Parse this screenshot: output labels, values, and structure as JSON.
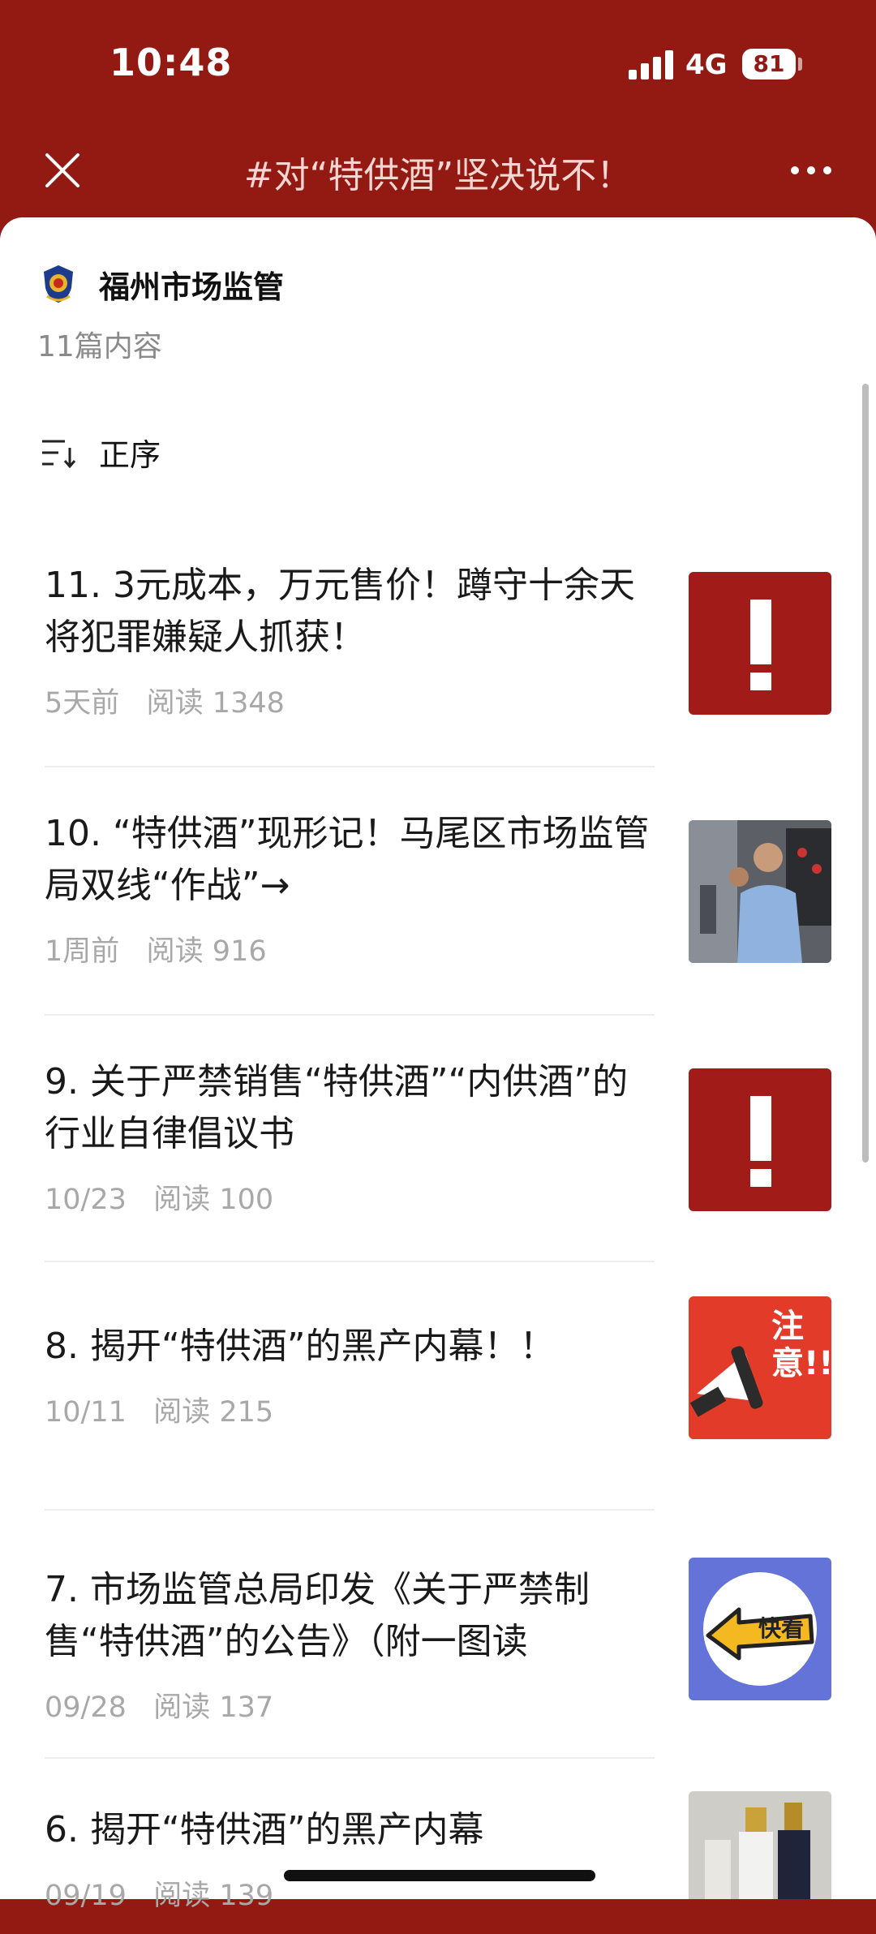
{
  "status": {
    "time": "10:48",
    "network": "4G",
    "battery": "81"
  },
  "nav": {
    "title": "#对“特供酒”坚决说不！"
  },
  "account": {
    "name": "福州市场监管",
    "content_count": "11篇内容"
  },
  "sort": {
    "label": "正序"
  },
  "articles": [
    {
      "title": "11. 3元成本，万元售价！蹲守十余天将犯罪嫌疑人抓获！",
      "time": "5天前",
      "reads": "阅读 1348",
      "thumb": "alert-exclamation"
    },
    {
      "title": "10. “特供酒”现形记！马尾区市场监管局双线“作战”→",
      "time": "1周前",
      "reads": "阅读 916",
      "thumb": "inspection-photo"
    },
    {
      "title": "9. 关于严禁销售“特供酒”“内供酒”的行业自律倡议书",
      "time": "10/23",
      "reads": "阅读 100",
      "thumb": "alert-exclamation"
    },
    {
      "title": "8. 揭开“特供酒”的黑产内幕！！",
      "time": "10/11",
      "reads": "阅读 215",
      "thumb": "notice-megaphone",
      "badge": "注意!!"
    },
    {
      "title": "7. 市场监管总局印发《关于严禁制售“特供酒”的公告》（附一图读",
      "time": "09/28",
      "reads": "阅读 137",
      "thumb": "quick-look",
      "badge": "快看"
    },
    {
      "title": "6. 揭开“特供酒”的黑产内幕",
      "time": "09/19",
      "reads": "阅读 139",
      "thumb": "liquor-bottles"
    }
  ],
  "colors": {
    "brand_red": "#931a12",
    "thumb_red": "#a11c19",
    "thumb_orange": "#e23b2a",
    "thumb_blue": "#6473d8"
  }
}
